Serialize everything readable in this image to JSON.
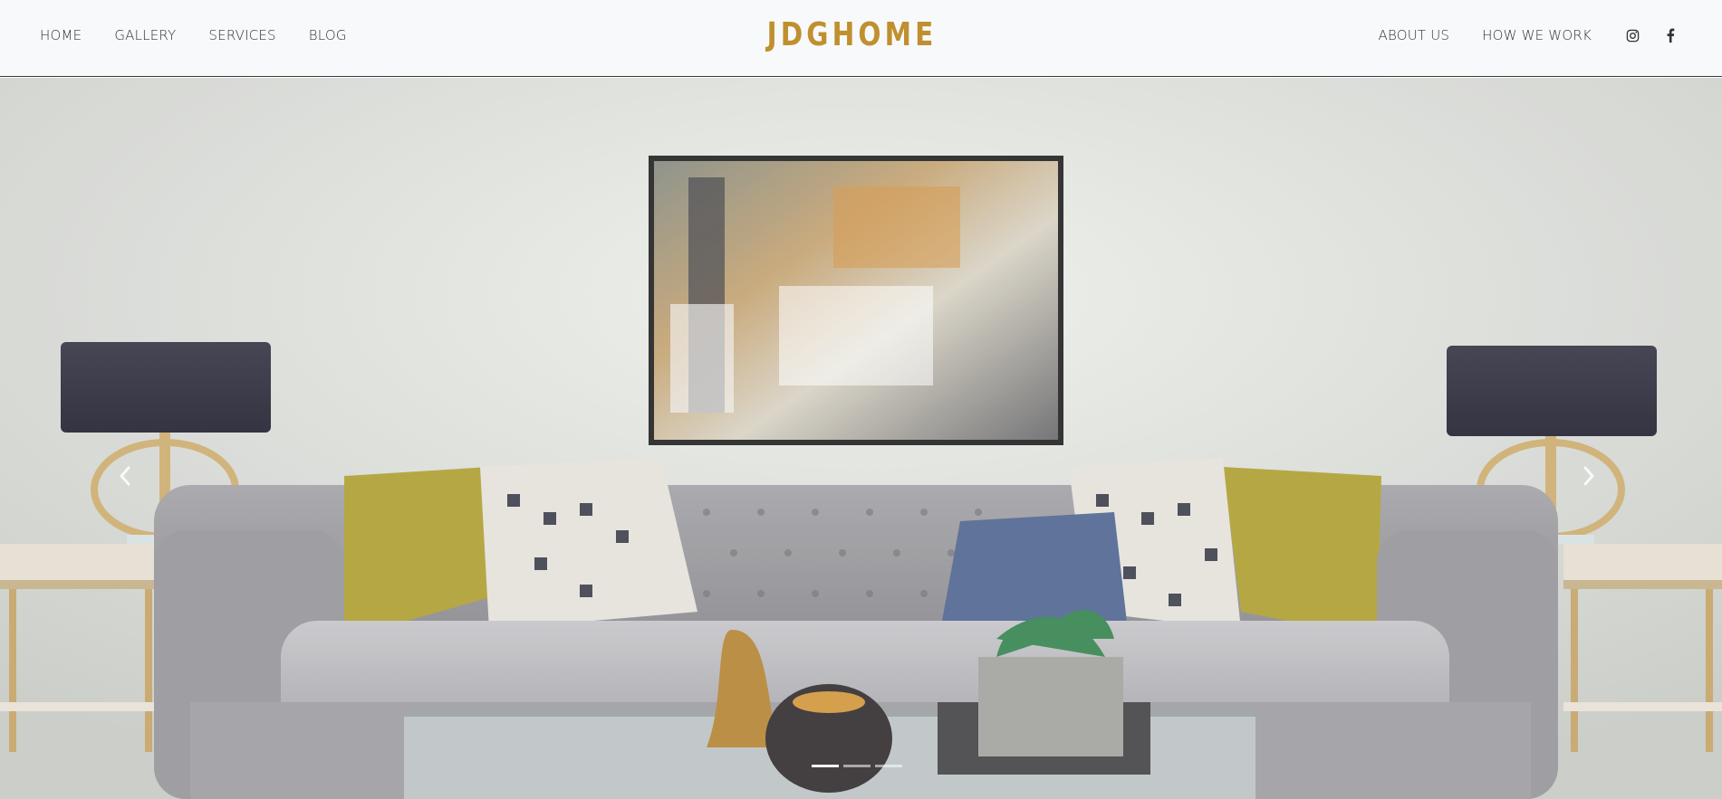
{
  "brand": {
    "logo": "JDGHOME",
    "color": "#c08f2f"
  },
  "nav": {
    "left": [
      {
        "label": "HOME"
      },
      {
        "label": "GALLERY"
      },
      {
        "label": "SERVICES"
      },
      {
        "label": "BLOG"
      }
    ],
    "right": [
      {
        "label": "ABOUT US"
      },
      {
        "label": "HOW WE WORK"
      }
    ],
    "social_icons": [
      "instagram-icon",
      "facebook-icon"
    ]
  },
  "hero": {
    "carousel": {
      "prev_icon": "chevron-left-icon",
      "next_icon": "chevron-right-icon",
      "slide_count": 3,
      "active_index": 0
    }
  },
  "colors": {
    "header_bg": "#f8f9fa",
    "text": "#333333"
  }
}
